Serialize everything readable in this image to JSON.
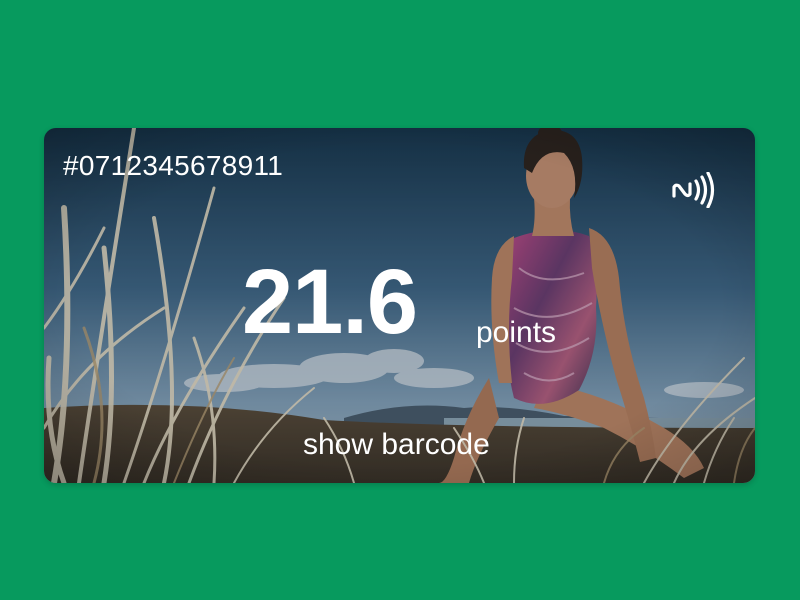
{
  "card": {
    "number": "#0712345678911",
    "points_value": "21.6",
    "points_unit": "points",
    "barcode_link": "show barcode",
    "nfc_icon": "contactless-icon"
  },
  "colors": {
    "page_background": "#079a5e",
    "text": "#ffffff",
    "sky_top": "#1b3d57",
    "sky_bottom": "#7c9ab3",
    "swimsuit_pink": "#b8457a",
    "grass": "#d9c9a8"
  }
}
